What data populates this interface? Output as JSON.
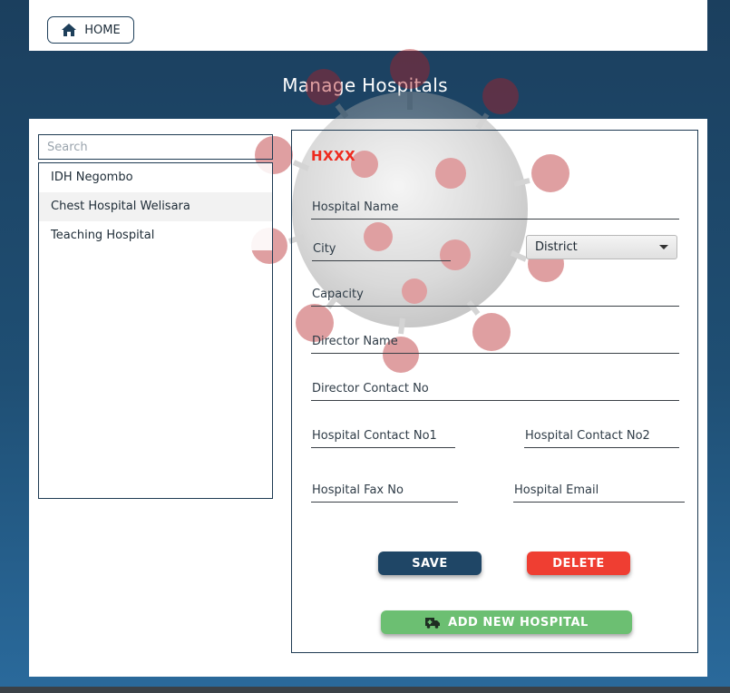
{
  "header": {
    "home_label": "HOME",
    "title": "Manage Hospitals"
  },
  "sidebar": {
    "search_placeholder": "Search",
    "items": [
      {
        "label": "IDH Negombo"
      },
      {
        "label": "Chest Hospital Welisara"
      },
      {
        "label": "Teaching Hospital"
      }
    ]
  },
  "form": {
    "hospital_id": "HXXX",
    "hospital_name_placeholder": "Hospital Name",
    "city_placeholder": "City",
    "district_value": "District",
    "capacity_placeholder": "Capacity",
    "director_name_placeholder": "Director Name",
    "director_contact_placeholder": "Director Contact No",
    "contact_no1_placeholder": "Hospital Contact No1",
    "contact_no2_placeholder": "Hospital Contact No2",
    "fax_placeholder": "Hospital Fax No",
    "email_placeholder": "Hospital Email"
  },
  "buttons": {
    "save": "SAVE",
    "delete": "DELETE",
    "add_new": "ADD NEW HOSPITAL"
  },
  "colors": {
    "header_bg": "#1b3f5e",
    "accent_red": "#ee2b1f",
    "save": "#1f4666",
    "delete": "#ef3e32",
    "add": "#6cbf72"
  },
  "icons": {
    "home": "home-icon",
    "ambulance": "ambulance-icon"
  }
}
